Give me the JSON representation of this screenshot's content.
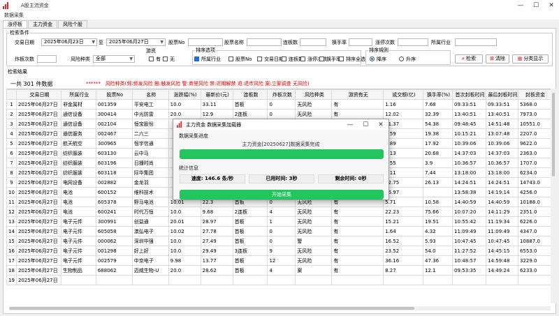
{
  "app": {
    "title": "A股主流资金",
    "menu": "数据采集"
  },
  "tabs": [
    "涨停板",
    "主力资金",
    "风险个股"
  ],
  "search": {
    "legend": "检索条件",
    "trade_date_label": "交易日期",
    "date_from": "2025年06月23日",
    "to_label": "至",
    "date_to": "2025年06月27日",
    "code_label": "股票No",
    "name_label": "股票名称",
    "board_label": "连板数",
    "turnover_label": "换手率",
    "limit_label": "涨停次数",
    "industry_label": "所属行业",
    "bomb_label": "炸板次数",
    "risk_label": "风险种类",
    "risk_value": "全部",
    "games_label": "游资",
    "games_yes": "有",
    "games_no": "无",
    "sort_items_legend": "排序选项",
    "sort_items": [
      "所属行业",
      "股票No",
      "交易日期",
      "连板数",
      "涨停次数",
      "换手率",
      "排序全选"
    ],
    "sort_order_legend": "排序規则",
    "asc": "降序",
    "desc": "升序",
    "btn_search": "检索",
    "btn_clear": "清除",
    "btn_category": "分类显示"
  },
  "results": {
    "legend": "检索结果",
    "count_text": "一共 301 件数据",
    "stars": "******",
    "risk_legend": "风险种类(频:频发风险 触:触发风险 警:商誉风险 禁:近期解禁 退:退市风险 案:立案调查 无风险)"
  },
  "table": {
    "columns": [
      "",
      "交易日期",
      "所属行业",
      "股票No",
      "名称",
      "涨跌幅(%)",
      "最新价(元)",
      "连板数",
      "炸板次数",
      "风险种类",
      "游资有无",
      "成交额(亿)",
      "换手率(%)",
      "首次封板时间",
      "最后封板时间",
      "封板资金"
    ],
    "rows": [
      [
        "1",
        "2025年06月27日",
        "非金属材",
        "001359",
        "平安电工",
        "10.0",
        "33.11",
        "首板",
        "0",
        "无风险",
        "有",
        "1.16",
        "7.68",
        "09:33:51",
        "09:33:51",
        "5368.0"
      ],
      [
        "2",
        "2025年06月27日",
        "通信设备",
        "300414",
        "中光防雷",
        "20.0",
        "12.9",
        "2连板",
        "0",
        "无风险",
        "有",
        "12.02",
        "32.39",
        "13:40:51",
        "13:40:51",
        "7973.0"
      ],
      [
        "3",
        "2025年06月27日",
        "通信设备",
        "002104",
        "恒宝股份",
        "",
        "",
        "",
        "",
        "",
        "",
        "51.37",
        "54.38",
        "09:48:45",
        "14:51:48",
        "10551.0"
      ],
      [
        "4",
        "2025年06月27日",
        "通信服务",
        "002467",
        "二六三",
        "",
        "",
        "",
        "",
        "",
        "",
        "6.59",
        "19.38",
        "10:15:21",
        "13:07:48",
        "2207.0"
      ],
      [
        "5",
        "2025年06月27日",
        "航天航空",
        "300965",
        "恒宇信通",
        "",
        "",
        "",
        "",
        "",
        "",
        "1.89",
        "17.92",
        "10:39:06",
        "10:39:06",
        "9622.0"
      ],
      [
        "6",
        "2025年06月27日",
        "纺织服装",
        "603130",
        "云中马",
        "",
        "",
        "",
        "",
        "",
        "",
        "1.13",
        "20.68",
        "14:37:03",
        "14:37:03",
        "2363.0"
      ],
      [
        "7",
        "2025年06月27日",
        "纺织服装",
        "603196",
        "日播时尚",
        "",
        "",
        "",
        "",
        "",
        "",
        "5.55",
        "3.9",
        "10:36:57",
        "10:36:57",
        "1707.0"
      ],
      [
        "8",
        "2025年06月27日",
        "纺织服装",
        "603118",
        "际华集团",
        "",
        "",
        "",
        "",
        "",
        "",
        "1.11",
        "7.44",
        "13:18:00",
        "13:18:00",
        "6234.0"
      ],
      [
        "9",
        "2025年06月27日",
        "电网设备",
        "002882",
        "金龙羽",
        "",
        "",
        "",
        "",
        "",
        "",
        "12.75",
        "26.13",
        "14:24:51",
        "14:24:51",
        "14743.0"
      ],
      [
        "10",
        "2025年06月27日",
        "电池",
        "600152",
        "维科技术",
        "",
        "",
        "",
        "",
        "",
        "",
        "16.97",
        "",
        "13:58:38",
        "14:19:14",
        "4256.0"
      ],
      [
        "11",
        "2025年06月27日",
        "电池",
        "605378",
        "野马电池",
        "10.01",
        "22.3",
        "首板",
        "0",
        "无风险",
        "有",
        "5.71",
        "10.58",
        "14:40:59",
        "14:40:59",
        "10188.0"
      ],
      [
        "12",
        "2025年06月27日",
        "电池",
        "600241",
        "时代万恒",
        "10.0",
        "9.68",
        "2连板",
        "4",
        "无风险",
        "有",
        "22.23",
        "75.66",
        "10:07:20",
        "14:11:29",
        "2351.0"
      ],
      [
        "13",
        "2025年06月27日",
        "电子元件",
        "300991",
        "创益通",
        "20.01",
        "28.97",
        "首板",
        "1",
        "无风险",
        "有",
        "15.21",
        "19.51",
        "10:55:42",
        "11:19:34",
        "6226.0"
      ],
      [
        "14",
        "2025年06月27日",
        "电子元件",
        "605058",
        "澳弘电子",
        "10.02",
        "27.78",
        "首板",
        "0",
        "无风险",
        "有",
        "1.64",
        "4.32",
        "11:09:49",
        "11:09:49",
        "4347.0"
      ],
      [
        "15",
        "2025年06月27日",
        "电子元件",
        "000062",
        "深圳华强",
        "10.0",
        "27.49",
        "首板",
        "0",
        "警",
        "有",
        "16.52",
        "5.93",
        "10:47:45",
        "10:47:45",
        "10887.0"
      ],
      [
        "16",
        "2025年06月27日",
        "电子元件",
        "001298",
        "好上好",
        "10.0",
        "29.49",
        "3连板",
        "9",
        "无风险",
        "有",
        "23.52",
        "54.0",
        "11:27:52",
        "14:45:15",
        "6553.0"
      ],
      [
        "17",
        "2025年06月27日",
        "电子元件",
        "002579",
        "中京电子",
        "9.98",
        "13.77",
        "首板",
        "12",
        "无风险",
        "有",
        "36.16",
        "47.36",
        "10:48:57",
        "14:59:48",
        "3229.0"
      ],
      [
        "18",
        "2025年06月27日",
        "生物制品",
        "688062",
        "迈威生物-U",
        "20.0",
        "28.62",
        "首板",
        "4",
        "案",
        "有",
        "8.27",
        "12.1",
        "09:53:35",
        "14:49:24",
        "6233.0"
      ],
      [
        "19",
        "2025年06月27日",
        "",
        "",
        "",
        "",
        "",
        "",
        "",
        "",
        "",
        "",
        "",
        "",
        "",
        ""
      ]
    ]
  },
  "dialog": {
    "title": "主力资金 数据采集加载器",
    "progress_label": "数据采集进度",
    "message": "主力资金[20250627]数据采集完成",
    "progress": 100,
    "stats_label": "统计信息",
    "speed": "速度: 146.6 条/秒",
    "elapsed": "已用时间: 3秒",
    "remaining": "剩余时间: 0秒",
    "start_btn": "开始采集"
  }
}
